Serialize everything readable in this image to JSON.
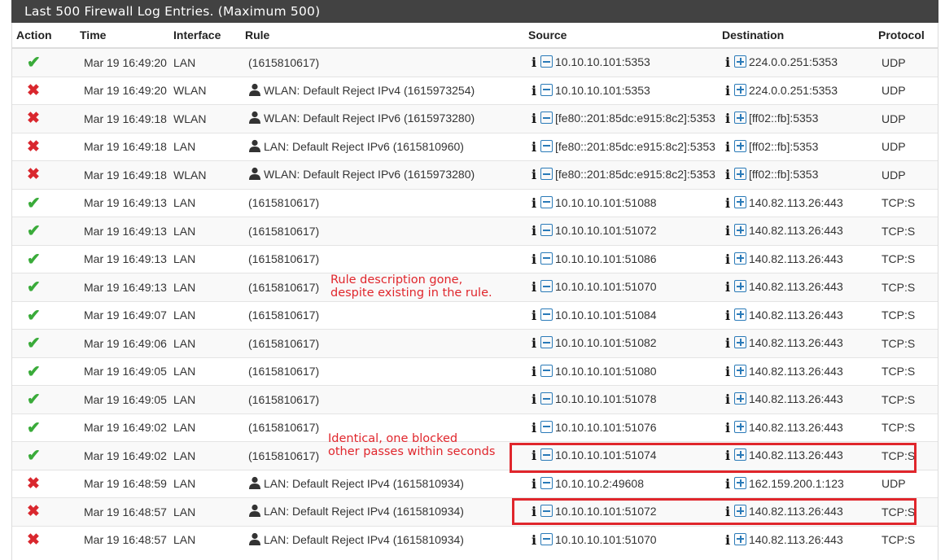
{
  "panel": {
    "title": "Last 500 Firewall Log Entries. (Maximum 500)"
  },
  "columns": {
    "action": "Action",
    "time": "Time",
    "interface": "Interface",
    "rule": "Rule",
    "source": "Source",
    "destination": "Destination",
    "protocol": "Protocol"
  },
  "colors": {
    "pass": "#3aab3a",
    "block": "#d9272e",
    "annotation": "#e0262c",
    "icon_blue": "#2a7ab8",
    "header_bg": "#424242"
  },
  "annotations": {
    "note1_line1": "Rule description gone,",
    "note1_line2": "despite existing in the rule.",
    "note2_line1": "Identical, one blocked",
    "note2_line2": "other passes within seconds"
  },
  "rows": [
    {
      "action": "pass",
      "time": "Mar 19 16:49:20",
      "interface": "LAN",
      "user": false,
      "rule": "(1615810617)",
      "source": "10.10.10.101:5353",
      "destination": "224.0.0.251:5353",
      "protocol": "UDP"
    },
    {
      "action": "block",
      "time": "Mar 19 16:49:20",
      "interface": "WLAN",
      "user": true,
      "rule": "WLAN: Default Reject IPv4 (1615973254)",
      "source": "10.10.10.101:5353",
      "destination": "224.0.0.251:5353",
      "protocol": "UDP"
    },
    {
      "action": "block",
      "time": "Mar 19 16:49:18",
      "interface": "WLAN",
      "user": true,
      "rule": "WLAN: Default Reject IPv6 (1615973280)",
      "source": "[fe80::201:85dc:e915:8c2]:5353",
      "destination": "[ff02::fb]:5353",
      "protocol": "UDP"
    },
    {
      "action": "block",
      "time": "Mar 19 16:49:18",
      "interface": "LAN",
      "user": true,
      "rule": "LAN: Default Reject IPv6 (1615810960)",
      "source": "[fe80::201:85dc:e915:8c2]:5353",
      "destination": "[ff02::fb]:5353",
      "protocol": "UDP"
    },
    {
      "action": "block",
      "time": "Mar 19 16:49:18",
      "interface": "WLAN",
      "user": true,
      "rule": "WLAN: Default Reject IPv6 (1615973280)",
      "source": "[fe80::201:85dc:e915:8c2]:5353",
      "destination": "[ff02::fb]:5353",
      "protocol": "UDP"
    },
    {
      "action": "pass",
      "time": "Mar 19 16:49:13",
      "interface": "LAN",
      "user": false,
      "rule": "(1615810617)",
      "source": "10.10.10.101:51088",
      "destination": "140.82.113.26:443",
      "protocol": "TCP:S"
    },
    {
      "action": "pass",
      "time": "Mar 19 16:49:13",
      "interface": "LAN",
      "user": false,
      "rule": "(1615810617)",
      "source": "10.10.10.101:51072",
      "destination": "140.82.113.26:443",
      "protocol": "TCP:S"
    },
    {
      "action": "pass",
      "time": "Mar 19 16:49:13",
      "interface": "LAN",
      "user": false,
      "rule": "(1615810617)",
      "source": "10.10.10.101:51086",
      "destination": "140.82.113.26:443",
      "protocol": "TCP:S"
    },
    {
      "action": "pass",
      "time": "Mar 19 16:49:13",
      "interface": "LAN",
      "user": false,
      "rule": "(1615810617)",
      "source": "10.10.10.101:51070",
      "destination": "140.82.113.26:443",
      "protocol": "TCP:S"
    },
    {
      "action": "pass",
      "time": "Mar 19 16:49:07",
      "interface": "LAN",
      "user": false,
      "rule": "(1615810617)",
      "source": "10.10.10.101:51084",
      "destination": "140.82.113.26:443",
      "protocol": "TCP:S"
    },
    {
      "action": "pass",
      "time": "Mar 19 16:49:06",
      "interface": "LAN",
      "user": false,
      "rule": "(1615810617)",
      "source": "10.10.10.101:51082",
      "destination": "140.82.113.26:443",
      "protocol": "TCP:S"
    },
    {
      "action": "pass",
      "time": "Mar 19 16:49:05",
      "interface": "LAN",
      "user": false,
      "rule": "(1615810617)",
      "source": "10.10.10.101:51080",
      "destination": "140.82.113.26:443",
      "protocol": "TCP:S"
    },
    {
      "action": "pass",
      "time": "Mar 19 16:49:05",
      "interface": "LAN",
      "user": false,
      "rule": "(1615810617)",
      "source": "10.10.10.101:51078",
      "destination": "140.82.113.26:443",
      "protocol": "TCP:S"
    },
    {
      "action": "pass",
      "time": "Mar 19 16:49:02",
      "interface": "LAN",
      "user": false,
      "rule": "(1615810617)",
      "source": "10.10.10.101:51076",
      "destination": "140.82.113.26:443",
      "protocol": "TCP:S"
    },
    {
      "action": "pass",
      "time": "Mar 19 16:49:02",
      "interface": "LAN",
      "user": false,
      "rule": "(1615810617)",
      "source": "10.10.10.101:51074",
      "destination": "140.82.113.26:443",
      "protocol": "TCP:S"
    },
    {
      "action": "block",
      "time": "Mar 19 16:48:59",
      "interface": "LAN",
      "user": true,
      "rule": "LAN: Default Reject IPv4 (1615810934)",
      "source": "10.10.10.2:49608",
      "destination": "162.159.200.1:123",
      "protocol": "UDP"
    },
    {
      "action": "block",
      "time": "Mar 19 16:48:57",
      "interface": "LAN",
      "user": true,
      "rule": "LAN: Default Reject IPv4 (1615810934)",
      "source": "10.10.10.101:51072",
      "destination": "140.82.113.26:443",
      "protocol": "TCP:S"
    },
    {
      "action": "block",
      "time": "Mar 19 16:48:57",
      "interface": "LAN",
      "user": true,
      "rule": "LAN: Default Reject IPv4 (1615810934)",
      "source": "10.10.10.101:51070",
      "destination": "140.82.113.26:443",
      "protocol": "TCP:S"
    }
  ]
}
